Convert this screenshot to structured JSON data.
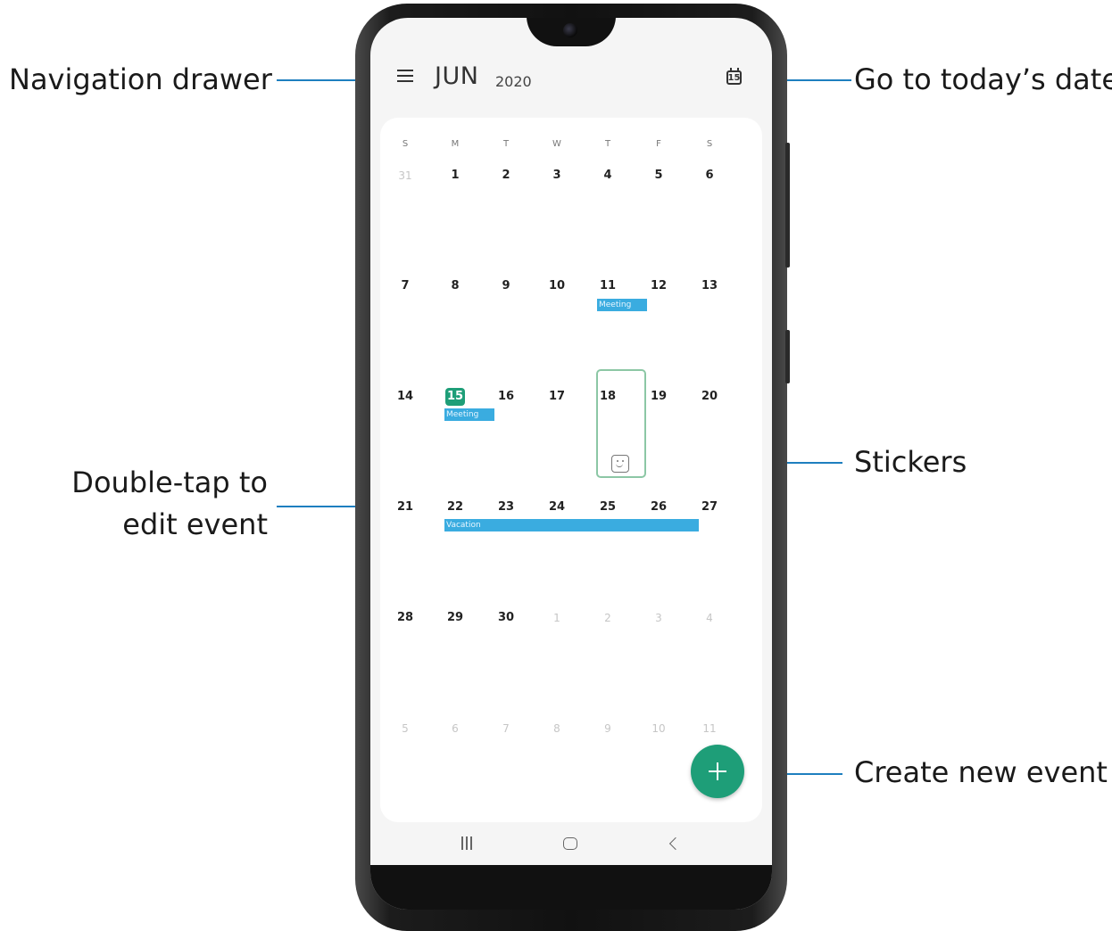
{
  "callouts": {
    "navigation_drawer": "Navigation drawer",
    "go_to_today": "Go to today’s date",
    "double_tap_line1": "Double-tap to",
    "double_tap_line2": "edit event",
    "stickers": "Stickers",
    "create_new_event": "Create new event"
  },
  "colors": {
    "accent": "#1e9e78",
    "event": "#3aace0",
    "leader_line": "#1e7fbf"
  },
  "header": {
    "menu_icon": "hamburger-icon",
    "month": "JUN",
    "year": "2020",
    "today_icon": "calendar-today-icon",
    "today_icon_number": "15"
  },
  "calendar": {
    "weekdays": [
      "S",
      "M",
      "T",
      "W",
      "T",
      "F",
      "S"
    ],
    "weeks": [
      [
        "31",
        "1",
        "2",
        "3",
        "4",
        "5",
        "6"
      ],
      [
        "7",
        "8",
        "9",
        "10",
        "11",
        "12",
        "13"
      ],
      [
        "14",
        "15",
        "16",
        "17",
        "18",
        "19",
        "20"
      ],
      [
        "21",
        "22",
        "23",
        "24",
        "25",
        "26",
        "27"
      ],
      [
        "28",
        "29",
        "30",
        "1",
        "2",
        "3",
        "4"
      ],
      [
        "5",
        "6",
        "7",
        "8",
        "9",
        "10",
        "11"
      ]
    ],
    "today": "15",
    "selected_day": "18",
    "events": {
      "meeting_11": "Meeting",
      "meeting_15": "Meeting",
      "vacation": "Vacation"
    },
    "sticker_icon": "sticker-icon"
  },
  "fab": {
    "icon": "plus-icon"
  },
  "navbar": {
    "recents_icon": "recents-icon",
    "home_icon": "home-icon",
    "back_icon": "back-icon"
  }
}
